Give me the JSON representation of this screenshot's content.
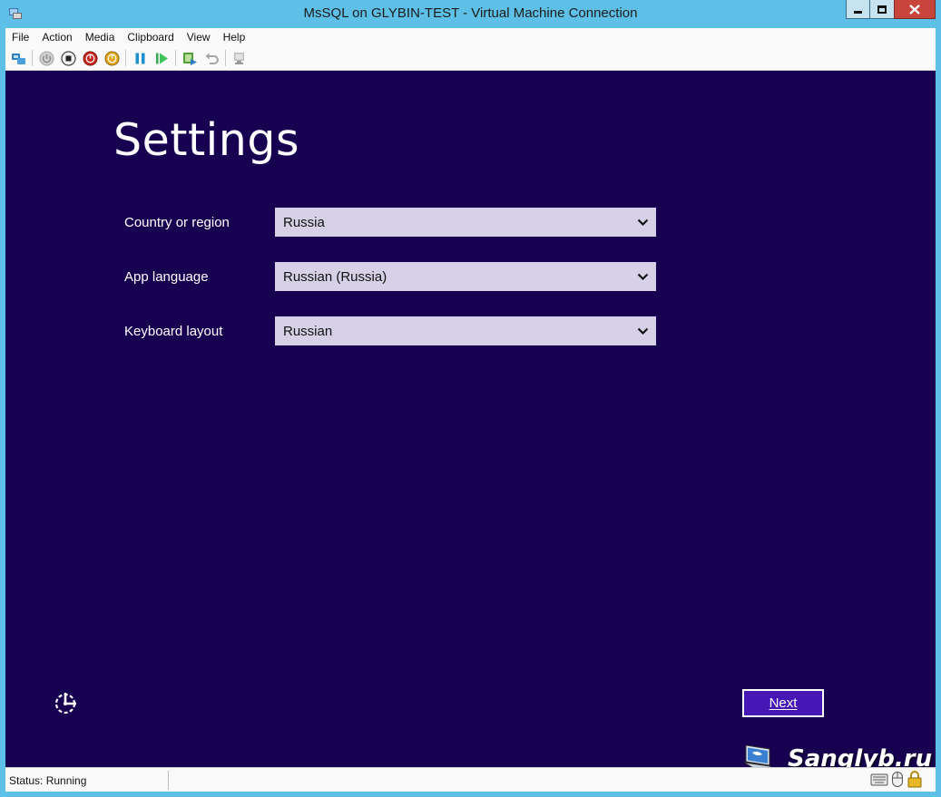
{
  "window": {
    "title": "MsSQL on GLYBIN-TEST - Virtual Machine Connection"
  },
  "menu": {
    "items": [
      {
        "label": "File"
      },
      {
        "label": "Action"
      },
      {
        "label": "Media"
      },
      {
        "label": "Clipboard"
      },
      {
        "label": "View"
      },
      {
        "label": "Help"
      }
    ]
  },
  "toolbar": {
    "icons": [
      "ctrl-alt-del-icon",
      "start-icon",
      "turn-off-icon",
      "shut-down-icon",
      "save-icon",
      "pause-icon",
      "reset-icon",
      "checkpoint-icon",
      "revert-icon",
      "enhanced-session-icon"
    ]
  },
  "setup": {
    "heading": "Settings",
    "fields": [
      {
        "label": "Country or region",
        "value": "Russia"
      },
      {
        "label": "App language",
        "value": "Russian (Russia)"
      },
      {
        "label": "Keyboard layout",
        "value": "Russian"
      }
    ],
    "next_label": "Next"
  },
  "watermark": {
    "text": "Sanglyb.ru"
  },
  "status": {
    "text": "Status: Running"
  },
  "colors": {
    "screen_bg": "#180051",
    "select_bg": "#d6d1e6",
    "button_bg": "#4617b4",
    "window_frame": "#5ec0e6"
  }
}
